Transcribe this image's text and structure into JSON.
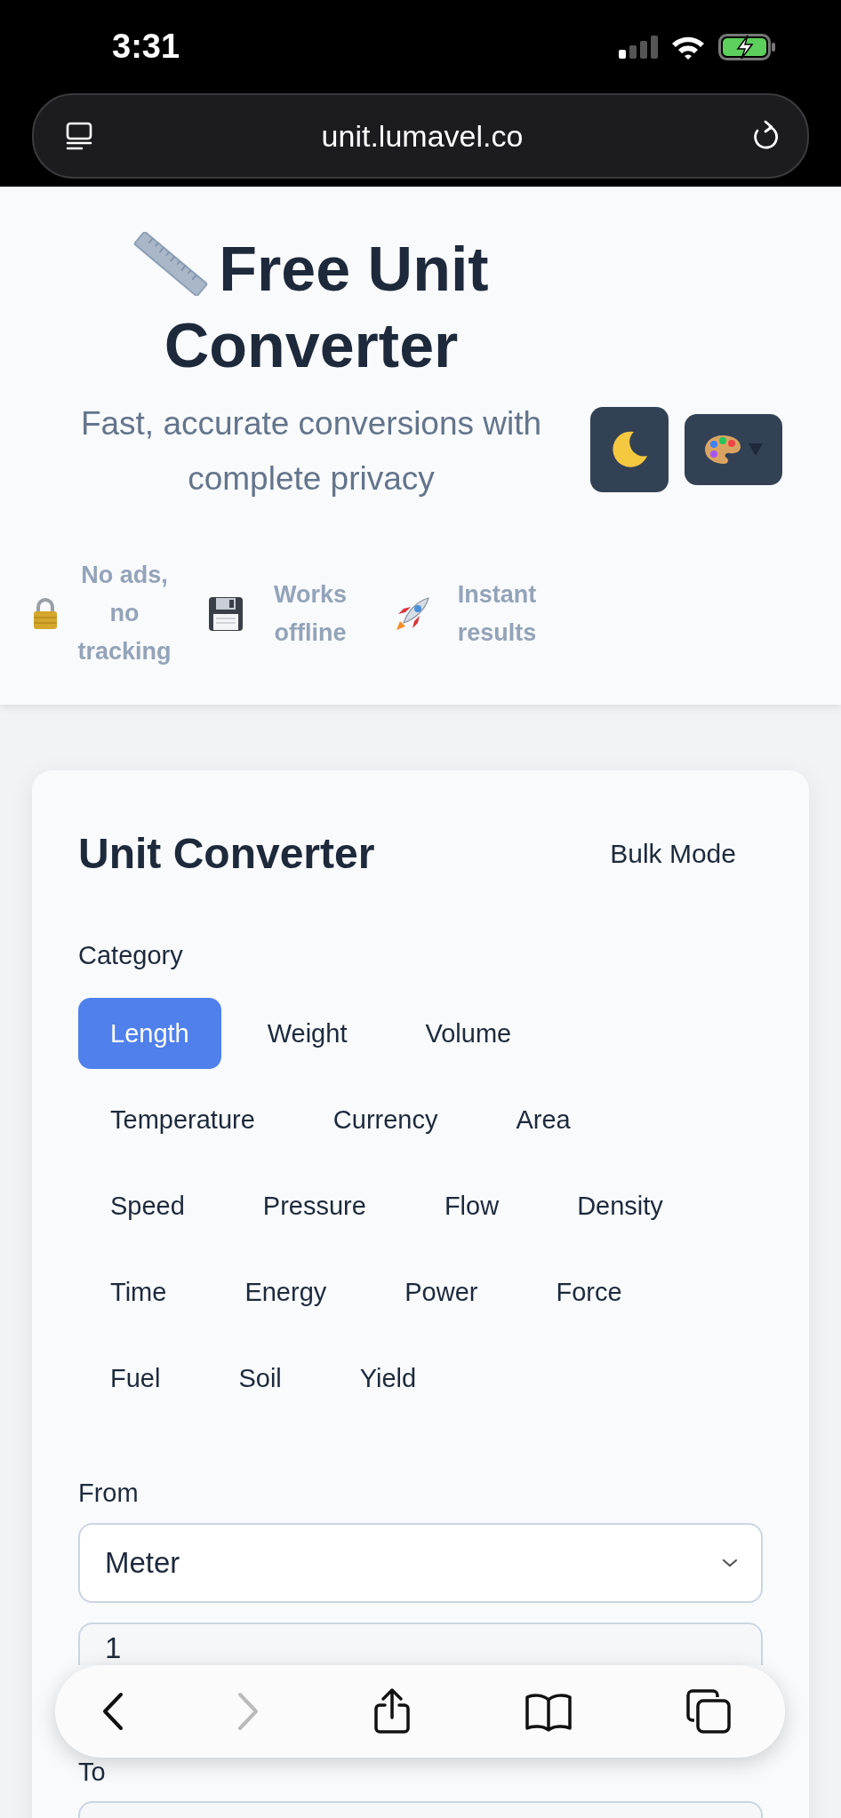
{
  "status_bar": {
    "time": "3:31"
  },
  "browser": {
    "url": "unit.lumavel.co",
    "back_enabled": true,
    "forward_enabled": false
  },
  "header": {
    "title": "Free Unit Converter",
    "subtitle": "Fast, accurate conversions with complete privacy",
    "features": [
      {
        "kind": "lock",
        "label": "No ads, no tracking"
      },
      {
        "kind": "disk",
        "label": "Works offline"
      },
      {
        "kind": "rocket",
        "label": "Instant results"
      }
    ]
  },
  "card": {
    "title": "Unit Converter",
    "bulk_button": "Bulk Mode",
    "category_label": "Category",
    "categories": [
      {
        "label": "Length",
        "selected": true
      },
      {
        "label": "Weight",
        "selected": false
      },
      {
        "label": "Volume",
        "selected": false
      },
      {
        "label": "Temperature",
        "selected": false
      },
      {
        "label": "Currency",
        "selected": false
      },
      {
        "label": "Area",
        "selected": false
      },
      {
        "label": "Speed",
        "selected": false
      },
      {
        "label": "Pressure",
        "selected": false
      },
      {
        "label": "Flow",
        "selected": false
      },
      {
        "label": "Density",
        "selected": false
      },
      {
        "label": "Time",
        "selected": false
      },
      {
        "label": "Energy",
        "selected": false
      },
      {
        "label": "Power",
        "selected": false
      },
      {
        "label": "Force",
        "selected": false
      },
      {
        "label": "Fuel",
        "selected": false
      },
      {
        "label": "Soil",
        "selected": false
      },
      {
        "label": "Yield",
        "selected": false
      }
    ],
    "from": {
      "label": "From",
      "unit": "Meter",
      "value": "1"
    },
    "to": {
      "label": "To"
    }
  }
}
